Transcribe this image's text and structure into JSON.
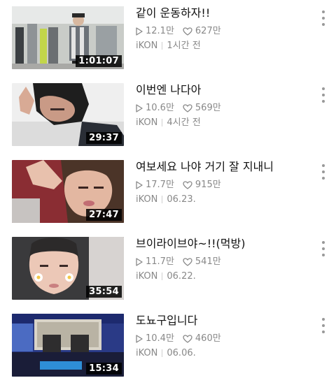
{
  "videos": [
    {
      "title": "같이 운동하자!!",
      "duration": "1:01:07",
      "plays": "12.1만",
      "likes": "627만",
      "channel": "iKON",
      "time": "1시간 전"
    },
    {
      "title": "이번엔 나다아",
      "duration": "29:37",
      "plays": "10.6만",
      "likes": "569만",
      "channel": "iKON",
      "time": "4시간 전"
    },
    {
      "title": "여보세요 나야 거기 잘 지내니",
      "duration": "27:47",
      "plays": "17.7만",
      "likes": "915만",
      "channel": "iKON",
      "time": "06.23."
    },
    {
      "title": "브이라이브야~!!(먹방)",
      "duration": "35:54",
      "plays": "11.7만",
      "likes": "541만",
      "channel": "iKON",
      "time": "06.22."
    },
    {
      "title": "도뇨구입니다",
      "duration": "15:34",
      "plays": "10.4만",
      "likes": "460만",
      "channel": "iKON",
      "time": "06.06."
    }
  ],
  "icons": {
    "play": "play-icon",
    "like": "heart-icon",
    "more": "more-vertical-icon"
  },
  "colors": {
    "meta_text": "#888888",
    "title_text": "#111111",
    "duration_bg": "#000000"
  }
}
